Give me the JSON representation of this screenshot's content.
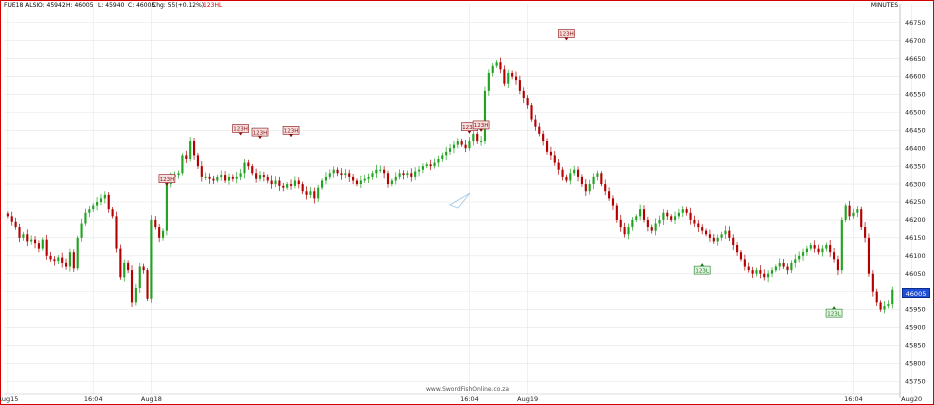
{
  "header": {
    "symbol": "FUE18 ALSI",
    "open": "O: 45942",
    "high": "H: 46005",
    "low": "L: 45940",
    "close": "C: 46005",
    "change": "Chg: 55(+0.12%)",
    "pattern_tag": "123HL",
    "interval": "MINUTES"
  },
  "watermark": "www.SwordFishOnline.co.za",
  "last_price": "46005",
  "colors": {
    "up": "#21a321",
    "down": "#b40000",
    "frame": "#d40000",
    "grid": "#e6e6e6",
    "price_tag": "#1f4fd8"
  },
  "chart_data": {
    "type": "candlestick",
    "y_ticks": [
      45750,
      45800,
      45850,
      45900,
      45950,
      46000,
      46050,
      46100,
      46150,
      46200,
      46250,
      46300,
      46350,
      46400,
      46450,
      46500,
      46550,
      46600,
      46650,
      46700,
      46750
    ],
    "ylim": [
      45720,
      46780
    ],
    "x_labels": [
      {
        "label": "Aug15",
        "bar": 0
      },
      {
        "label": "16:04",
        "bar": 22
      },
      {
        "label": "Aug18",
        "bar": 37
      },
      {
        "label": "16:04",
        "bar": 119
      },
      {
        "label": "Aug19",
        "bar": 134
      },
      {
        "label": "16:04",
        "bar": 218
      },
      {
        "label": "Aug20",
        "bar": 233
      }
    ],
    "markers": [
      {
        "text": "123H",
        "bar": 41,
        "value": 46315,
        "kind": "high"
      },
      {
        "text": "123H",
        "bar": 60,
        "value": 46455,
        "kind": "high"
      },
      {
        "text": "123H",
        "bar": 65,
        "value": 46445,
        "kind": "high"
      },
      {
        "text": "123H",
        "bar": 73,
        "value": 46450,
        "kind": "high"
      },
      {
        "text": "123H",
        "bar": 119,
        "value": 46460,
        "kind": "high"
      },
      {
        "text": "123H",
        "bar": 122,
        "value": 46465,
        "kind": "high"
      },
      {
        "text": "123H",
        "bar": 144,
        "value": 46720,
        "kind": "high"
      },
      {
        "text": "123L",
        "bar": 179,
        "value": 46060,
        "kind": "low"
      },
      {
        "text": "123L",
        "bar": 213,
        "value": 45940,
        "kind": "low"
      }
    ],
    "closes": [
      46210,
      46195,
      46180,
      46150,
      46160,
      46140,
      46145,
      46135,
      46120,
      46145,
      46100,
      46090,
      46085,
      46095,
      46080,
      46070,
      46110,
      46065,
      46150,
      46190,
      46220,
      46230,
      46240,
      46250,
      46260,
      46270,
      46230,
      46210,
      46120,
      46040,
      46080,
      46060,
      45970,
      46010,
      46070,
      46060,
      45980,
      46200,
      46180,
      46150,
      46170,
      46300,
      46320,
      46325,
      46330,
      46380,
      46370,
      46420,
      46380,
      46350,
      46320,
      46320,
      46315,
      46310,
      46320,
      46325,
      46310,
      46320,
      46315,
      46320,
      46330,
      46360,
      46350,
      46330,
      46315,
      46325,
      46320,
      46310,
      46300,
      46310,
      46295,
      46290,
      46300,
      46295,
      46310,
      46300,
      46280,
      46270,
      46280,
      46260,
      46290,
      46310,
      46320,
      46330,
      46340,
      46330,
      46325,
      46330,
      46320,
      46310,
      46300,
      46310,
      46315,
      46320,
      46330,
      46340,
      46340,
      46330,
      46300,
      46310,
      46320,
      46330,
      46325,
      46330,
      46320,
      46335,
      46340,
      46350,
      46355,
      46350,
      46360,
      46370,
      46380,
      46390,
      46400,
      46410,
      46420,
      46410,
      46400,
      46420,
      46440,
      46420,
      46420,
      46560,
      46610,
      46630,
      46640,
      46620,
      46580,
      46610,
      46600,
      46590,
      46560,
      46540,
      46520,
      46480,
      46460,
      46440,
      46420,
      46390,
      46380,
      46360,
      46340,
      46320,
      46310,
      46330,
      46340,
      46320,
      46300,
      46280,
      46300,
      46320,
      46330,
      46300,
      46280,
      46260,
      46240,
      46200,
      46180,
      46160,
      46180,
      46200,
      46210,
      46230,
      46200,
      46180,
      46170,
      46190,
      46200,
      46220,
      46210,
      46200,
      46210,
      46220,
      46230,
      46220,
      46200,
      46190,
      46180,
      46170,
      46160,
      46150,
      46140,
      46150,
      46160,
      46170,
      46150,
      46130,
      46110,
      46090,
      46070,
      46060,
      46050,
      46060,
      46050,
      46040,
      46050,
      46060,
      46070,
      46080,
      46070,
      46060,
      46080,
      46090,
      46100,
      46110,
      46120,
      46130,
      46120,
      46110,
      46120,
      46130,
      46110,
      46090,
      46060,
      46200,
      46240,
      46210,
      46220,
      46230,
      46180,
      46150,
      46050,
      46000,
      45970,
      45950,
      45960,
      45965,
      46005
    ]
  }
}
